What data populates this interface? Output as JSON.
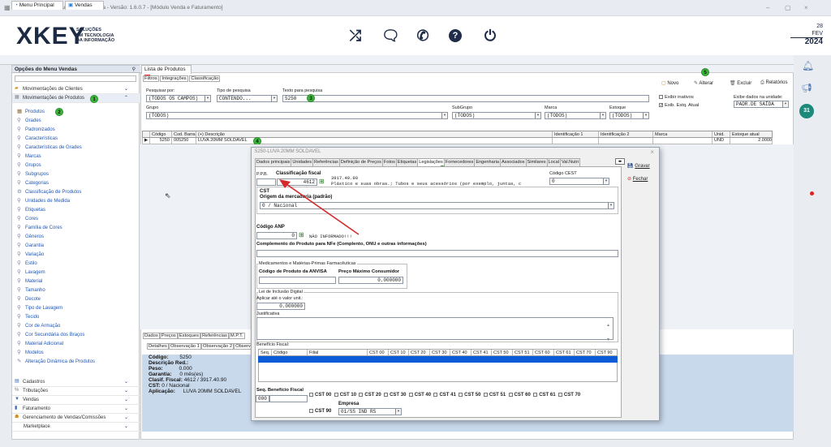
{
  "window": {
    "title": "SAX ERP © 2023 - Acesso ao Sistema - Versão: 1.6.0.7 - [Módulo Venda e Faturamento]",
    "min": "–",
    "max": "▢",
    "close": "×"
  },
  "brand": {
    "logo": "XKEY",
    "sub1": "SOLUÇÕES",
    "sub2": "EM TECNOLOGIA",
    "sub3": "DA INFORMAÇÃO"
  },
  "toolbar": {
    "shuffle": "⤮",
    "chat": "🗨",
    "whatsapp": "✆",
    "help": "?",
    "power": "⏻"
  },
  "date": {
    "day": "28",
    "month": "FEV",
    "year": "2024"
  },
  "tabs": {
    "main": "Menu Principal",
    "vendas": "Vendas"
  },
  "sidebar": {
    "title": "Opções do Menu Vendas",
    "groups_top": [
      {
        "label": "Movimentações de Clientes"
      },
      {
        "label": "Movimentações de Produtos",
        "badge": "1"
      }
    ],
    "items": [
      {
        "label": "Produtos",
        "badge": "2"
      },
      {
        "label": "Grades"
      },
      {
        "label": "Padronizados"
      },
      {
        "label": "Características"
      },
      {
        "label": "Características de Grades"
      },
      {
        "label": "Marcas"
      },
      {
        "label": "Grupos"
      },
      {
        "label": "Subgrupos"
      },
      {
        "label": "Categorias"
      },
      {
        "label": "Classificação de Produtos"
      },
      {
        "label": "Unidades de Medida"
      },
      {
        "label": "Etiquetas"
      },
      {
        "label": "Cores"
      },
      {
        "label": "Família de Cores"
      },
      {
        "label": "Gêneros"
      },
      {
        "label": "Garantia"
      },
      {
        "label": "Variação"
      },
      {
        "label": "Estilo"
      },
      {
        "label": "Lavagem"
      },
      {
        "label": "Material"
      },
      {
        "label": "Tamanho"
      },
      {
        "label": "Decote"
      },
      {
        "label": "Tipo de Lavagem"
      },
      {
        "label": "Tecido"
      },
      {
        "label": "Cor de Armação"
      },
      {
        "label": "Cor Secundária dos Braços"
      },
      {
        "label": "Material Adicional"
      },
      {
        "label": "Modelos"
      },
      {
        "label": "Alteração Dinâmica de Produtos"
      }
    ],
    "groups_bottom": [
      {
        "label": "Cadastros"
      },
      {
        "label": "Tributações"
      },
      {
        "label": "Vendas"
      },
      {
        "label": "Faturamento"
      },
      {
        "label": "Gerenciamento de Vendas/Comissões"
      },
      {
        "label": "Marketplace"
      }
    ]
  },
  "list": {
    "tab": "Lista de Produtos",
    "subtabs": [
      "Filtros",
      "Integrações",
      "Classificação"
    ],
    "pesquisar_por_label": "Pesquisar por:",
    "pesquisar_por": "(TODOS OS CAMPOS)",
    "tipo_label": "Tipo de pesquisa",
    "tipo": "CONTENDO...",
    "texto_label": "Texto para pesquisa",
    "texto": "5250",
    "badge3": "3",
    "grupo_label": "Grupo",
    "grupo": "(TODOS)",
    "subgrupo_label": "SubGrupo",
    "subgrupo": "(TODOS)",
    "marca_label": "Marca",
    "marca": "(TODOS)",
    "estoque_label": "Estoque",
    "estoque": "(TODOS)",
    "buttons": {
      "novo": "Novo",
      "alterar": "Alterar",
      "excluir": "Excluir",
      "relatorios": "Relatórios",
      "badge5": "5"
    },
    "exibir_inativos": "Exibir inativos",
    "exib_estq": "Exib. Estq. Atual",
    "exibe_dados_label": "Exibe dados na unidade:",
    "exibe_dados": "PADR.DE SAÍDA",
    "columns": [
      "Código",
      "Cod. Barra",
      "(+) Descrição",
      "Identificação 1",
      "Identificação 2",
      "Marca",
      "Unid.",
      "Estoque atual"
    ],
    "row": {
      "codigo": "5250",
      "barra": "005250",
      "descricao": "LUVA 20MM SOLDAVEL",
      "unid": "UND",
      "estoque": "2.0000",
      "badge4": "4"
    }
  },
  "bottom": {
    "tabs": [
      "Dados",
      "Preços",
      "Estoques",
      "Referências",
      "M.P.T."
    ],
    "subtabs": [
      "Detalhes",
      "Observação 1",
      "Observação 2",
      "Observ"
    ],
    "fields": [
      {
        "k": "Código:",
        "v": "5250"
      },
      {
        "k": "Descrição Red.:",
        "v": ""
      },
      {
        "k": "Peso:",
        "v": "0.000"
      },
      {
        "k": "Garantia:",
        "v": "0 mês(es)"
      },
      {
        "k": "Clasif. Fiscal:",
        "v": "4612 / 3917.40.90"
      },
      {
        "k": "CST:",
        "v": "0 / Nacional"
      },
      {
        "k": "Aplicação:",
        "v": "LUVA 20MM SOLDAVEL"
      }
    ]
  },
  "modal": {
    "title": "5250-LUVA 20MM SOLDAVEL",
    "close": "×",
    "tabs": [
      "Dados principais",
      "Unidades",
      "Referências",
      "Definição de Preços",
      "Fotos",
      "Etiquetas",
      "Legislações",
      "Fornecedores",
      "Engenharia",
      "Associados",
      "Similares",
      "Local",
      "Val.Nutri"
    ],
    "badge6": "6",
    "gravar": "Gravar",
    "fechar": "Fechar",
    "ppb": "P.P.B.",
    "class_fiscal_label": "Classificação fiscal",
    "class_fiscal": "4612",
    "ncm": "3917.40.90",
    "ncm_desc": "Plástico e suas obras.; Tubos e seus acessórios (por exemplo, juntas, c",
    "codigo_cest_label": "Código CEST",
    "codigo_cest": "0",
    "cst_label": "CST",
    "origem_label": "Origem da mercadoria (padrão)",
    "origem": "0 / Nacional",
    "anp_label": "Código ANP",
    "anp": "0",
    "anp_desc": "NÃO INFORMADO!!!",
    "complemento_label": "Complemento do Produto para NFe (Complento, ONU e outras informações)",
    "med_label": "Medicamentos e Matérias-Primas Farmacêuticas",
    "anvisa_label": "Código de Produto da ANVISA",
    "pmc_label": "Preço Máximo Consumidor",
    "pmc": "0.000000",
    "lei_label": "Lei de Inclusão Digital",
    "aplicar_label": "Aplicar até o valor unit.:",
    "aplicar": "0.000000",
    "justificativa_label": "Justificativa",
    "beneficio_label": "Benefício Fiscal:",
    "bcols": [
      "Seq.",
      "Código",
      "Filial",
      "CST 00",
      "CST 10",
      "CST 20",
      "CST 30",
      "CST 40",
      "CST 41",
      "CST 50",
      "CST 51",
      "CST 60",
      "CST 61",
      "CST 70",
      "CST 90"
    ],
    "seq_label": "Seq.",
    "benef_label": "Benefício Fiscal",
    "seq": "000",
    "csts": [
      "CST 00",
      "CST 10",
      "CST 20",
      "CST 30",
      "CST 40",
      "CST 41",
      "CST 50",
      "CST 51",
      "CST 60",
      "CST 61",
      "CST 70"
    ],
    "cst90": "CST 90",
    "empresa_label": "Empresa",
    "empresa": "01/SS IND RS"
  }
}
